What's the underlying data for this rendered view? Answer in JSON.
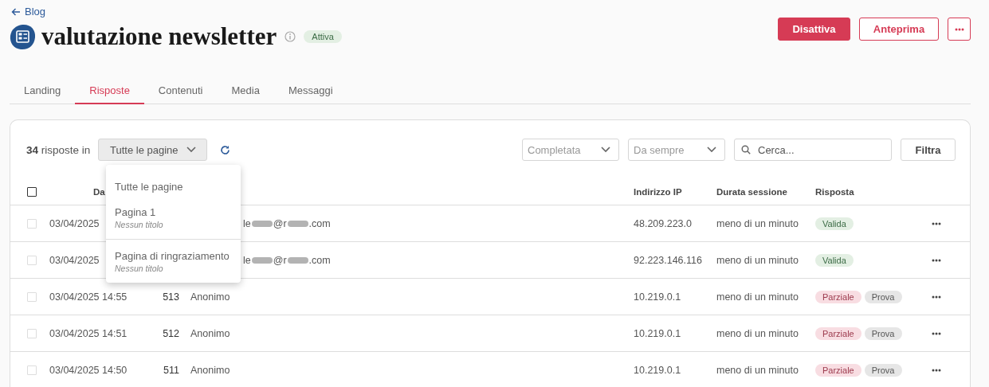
{
  "back_link": "Blog",
  "page": {
    "title": "valutazione newsletter",
    "status": "Attiva"
  },
  "actions": [
    {
      "label": "Disattiva",
      "kind": "primary"
    },
    {
      "label": "Anteprima",
      "kind": "outline"
    },
    {
      "kind": "more"
    }
  ],
  "tabs": [
    {
      "label": "Landing",
      "selected": false
    },
    {
      "label": "Risposte",
      "selected": true
    },
    {
      "label": "Contenuti",
      "selected": false
    },
    {
      "label": "Media",
      "selected": false
    },
    {
      "label": "Messaggi",
      "selected": false
    }
  ],
  "toolbar": {
    "count": "34",
    "count_label": "risposte in",
    "page_select": "Tutte le pagine",
    "status_filter": {
      "placeholder": "Completata"
    },
    "period_filter": {
      "placeholder": "Da sempre"
    },
    "search": {
      "placeholder": "Cerca..."
    },
    "filter_button": "Filtra"
  },
  "page_dropdown": [
    {
      "label": "Tutte le pagine",
      "separated": false
    },
    {
      "label": "Pagina 1",
      "subtitle": "Nessun titolo",
      "separated": false
    },
    {
      "label": "Pagina di ringraziamento",
      "subtitle": "Nessun titolo",
      "separated": true
    }
  ],
  "table": {
    "all_checked": false,
    "columns": [
      {
        "label": "Da",
        "kind": "date"
      },
      {
        "label": "Indirizzo IP",
        "kind": "ip"
      },
      {
        "label": "Durata sessione",
        "kind": "duration"
      },
      {
        "label": "Risposta",
        "kind": "answer"
      }
    ],
    "rows": [
      {
        "checked": false,
        "date": "03/04/2025",
        "user_parts": [
          "le",
          "@r",
          ".com"
        ],
        "ip": "48.209.223.0",
        "duration": "meno di un minuto",
        "tags": [
          {
            "label": "Valida",
            "kind": "valid"
          }
        ]
      },
      {
        "checked": false,
        "date": "03/04/2025",
        "user_parts": [
          "le",
          "@r",
          ".com"
        ],
        "ip": "92.223.146.116",
        "duration": "meno di un minuto",
        "tags": [
          {
            "label": "Valida",
            "kind": "valid"
          }
        ]
      },
      {
        "checked": false,
        "date": "03/04/2025 14:55",
        "id": "513",
        "user": "Anonimo",
        "ip": "10.219.0.1",
        "duration": "meno di un minuto",
        "tags": [
          {
            "label": "Parziale",
            "kind": "partial"
          },
          {
            "label": "Prova",
            "kind": "test"
          }
        ]
      },
      {
        "checked": false,
        "date": "03/04/2025 14:51",
        "id": "512",
        "user": "Anonimo",
        "ip": "10.219.0.1",
        "duration": "meno di un minuto",
        "tags": [
          {
            "label": "Parziale",
            "kind": "partial"
          },
          {
            "label": "Prova",
            "kind": "test"
          }
        ]
      },
      {
        "checked": false,
        "date": "03/04/2025 14:50",
        "id": "511",
        "user": "Anonimo",
        "ip": "10.219.0.1",
        "duration": "meno di un minuto",
        "tags": [
          {
            "label": "Parziale",
            "kind": "partial"
          },
          {
            "label": "Prova",
            "kind": "test"
          }
        ]
      }
    ]
  }
}
